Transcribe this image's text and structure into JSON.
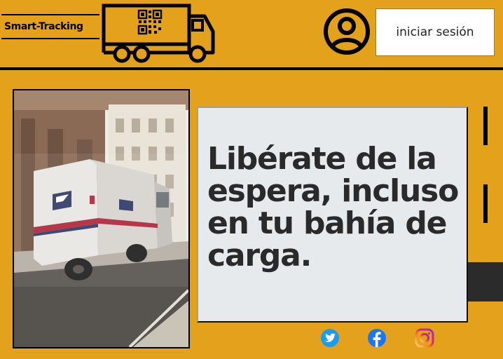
{
  "header": {
    "brand": "Smart-Tracking",
    "login_label": "iniciar sesión"
  },
  "hero": {
    "headline": "Libérate de la espera, incluso en tu bahía de carga."
  },
  "icons": {
    "truck": "truck-icon",
    "qr": "qr-code-icon",
    "user": "user-account-icon",
    "twitter": "twitter-icon",
    "facebook": "facebook-icon",
    "instagram": "instagram-icon"
  },
  "colors": {
    "background": "#e4a11b",
    "card": "#e6eaec",
    "text": "#2a2a2a",
    "twitter": "#1d9bf0",
    "facebook": "#1877f2"
  }
}
